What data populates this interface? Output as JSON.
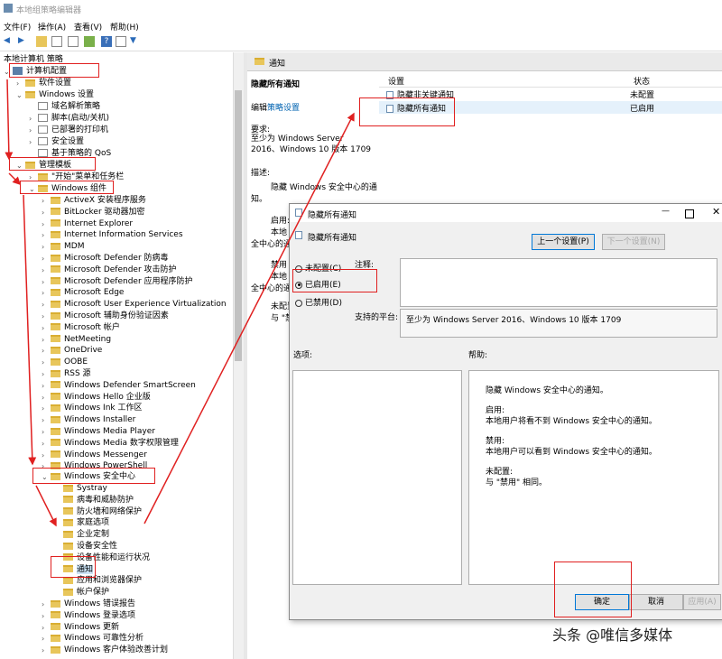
{
  "window": {
    "title": "本地组策略编辑器"
  },
  "menu": [
    "文件(F)",
    "操作(A)",
    "查看(V)",
    "帮助(H)"
  ],
  "tree": {
    "root": "本地计算机 策略",
    "computer_config": "计算机配置",
    "software_settings": "软件设置",
    "windows_settings": "Windows 设置",
    "ws_children": [
      "域名解析策略",
      "脚本(启动/关机)",
      "已部署的打印机",
      "安全设置",
      "基于策略的 QoS"
    ],
    "admin_templates": "管理模板",
    "start_menu": "\"开始\"菜单和任务栏",
    "windows_components": "Windows 组件",
    "components": [
      "ActiveX 安装程序服务",
      "BitLocker 驱动器加密",
      "Internet Explorer",
      "Internet Information Services",
      "MDM",
      "Microsoft Defender 防病毒",
      "Microsoft Defender 攻击防护",
      "Microsoft Defender 应用程序防护",
      "Microsoft Edge",
      "Microsoft User Experience Virtualization",
      "Microsoft 辅助身份验证因素",
      "Microsoft 帐户",
      "NetMeeting",
      "OneDrive",
      "OOBE",
      "RSS 源",
      "Windows Defender SmartScreen",
      "Windows Hello 企业版",
      "Windows Ink 工作区",
      "Windows Installer",
      "Windows Media Player",
      "Windows Media 数字权限管理",
      "Windows Messenger",
      "Windows PowerShell"
    ],
    "security_center": "Windows 安全中心",
    "sc_children": [
      "Systray",
      "病毒和威胁防护",
      "防火墙和网络保护",
      "家庭选项",
      "企业定制",
      "设备安全性",
      "设备性能和运行状况",
      "通知",
      "应用和浏览器保护",
      "帐户保护"
    ],
    "after": [
      "Windows 错误报告",
      "Windows 登录选项",
      "Windows 更新",
      "Windows 可靠性分析",
      "Windows 客户体验改善计划"
    ]
  },
  "right": {
    "header": "通知",
    "policy_title": "隐藏所有通知",
    "edit_prefix": "编辑",
    "edit_link": "策略设置",
    "req_label": "要求:",
    "req_text": "至少为 Windows Server 2016、Windows 10 版本 1709",
    "desc_label": "描述:",
    "desc_lines": [
      "隐藏 Windows 安全中心的通",
      "知。",
      "启用:",
      "本地",
      "全中心的通",
      "禁用",
      "本地",
      "全中心的通",
      "未配置",
      "与 \"禁用\""
    ],
    "col_setting": "设置",
    "col_state": "状态",
    "rows": [
      {
        "name": "隐藏非关键通知",
        "state": "未配置"
      },
      {
        "name": "隐藏所有通知",
        "state": "已启用"
      }
    ]
  },
  "dialog": {
    "title": "隐藏所有通知",
    "subtitle": "隐藏所有通知",
    "prev": "上一个设置(P)",
    "next": "下一个设置(N)",
    "radio_nc": "未配置(C)",
    "radio_en": "已启用(E)",
    "radio_dis": "已禁用(D)",
    "comment_label": "注释:",
    "platform_label": "支持的平台:",
    "platform_value": "至少为 Windows Server 2016、Windows 10 版本 1709",
    "options_label": "选项:",
    "help_label": "帮助:",
    "help_lines": [
      "隐藏 Windows 安全中心的通知。",
      "启用:",
      "本地用户将看不到 Windows 安全中心的通知。",
      "禁用:",
      "本地用户可以看到 Windows 安全中心的通知。",
      "未配置:",
      "与 \"禁用\" 相同。"
    ],
    "ok": "确定",
    "cancel": "取消",
    "apply": "应用(A)"
  },
  "watermark": "头条 @唯信多媒体",
  "colors": {
    "annotation": "#e02020",
    "selection": "#cce4f7"
  }
}
